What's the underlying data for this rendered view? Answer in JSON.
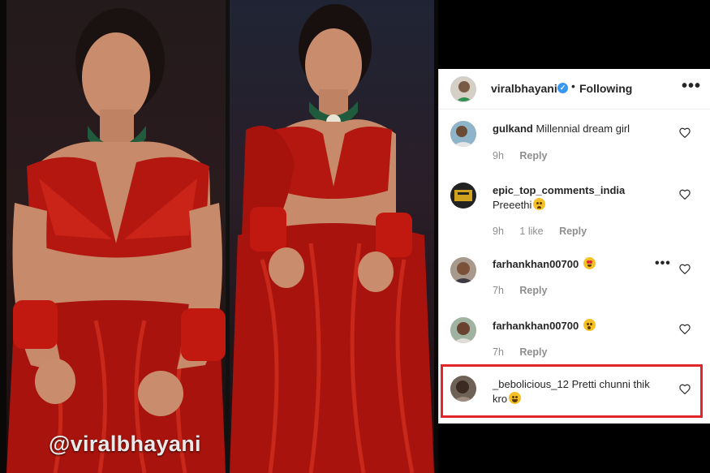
{
  "photo": {
    "watermark": "@viralbhayani"
  },
  "header": {
    "username": "viralbhayani",
    "verified_glyph": "✓",
    "separator": "•",
    "follow_status": "Following",
    "more_glyph": "•••"
  },
  "comments": [
    {
      "user": "gulkand",
      "text": "Millennial dream girl",
      "emoji": "",
      "time": "9h",
      "likes": "",
      "reply": "Reply",
      "highlighted": false
    },
    {
      "user": "epic_top_comments_india",
      "text": "Preeethi",
      "emoji": "frowning",
      "time": "9h",
      "likes": "1 like",
      "reply": "Reply",
      "highlighted": false
    },
    {
      "user": "farhankhan00700",
      "text": "",
      "emoji": "star-struck",
      "time": "7h",
      "likes": "",
      "reply": "Reply",
      "highlighted": false,
      "more_glyph": "•••"
    },
    {
      "user": "farhankhan00700",
      "text": "",
      "emoji": "astonished",
      "time": "7h",
      "likes": "",
      "reply": "Reply",
      "highlighted": false
    },
    {
      "user": "_bebolicious_12",
      "text": "Pretti chunni thik kro",
      "emoji": "laughing",
      "time": "",
      "likes": "",
      "reply": "",
      "highlighted": true
    }
  ],
  "colors": {
    "highlight_border": "#e3242b",
    "verified_blue": "#3897f0",
    "meta_grey": "#8e8e8e",
    "text_dark": "#262626"
  }
}
